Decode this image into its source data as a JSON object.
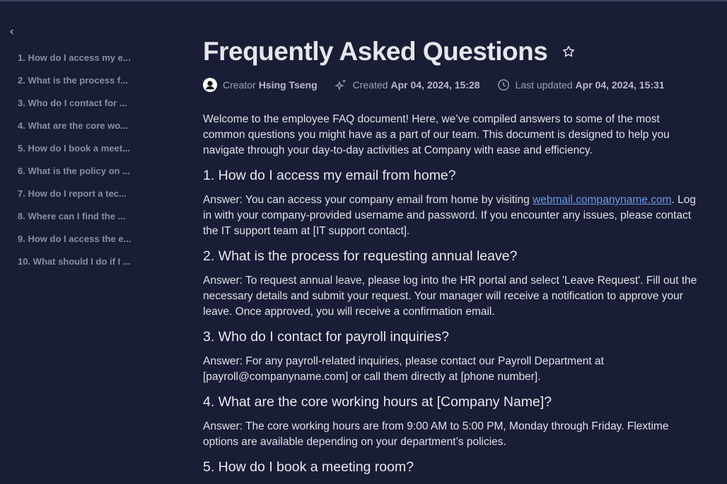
{
  "sidebar": {
    "back_icon": "chevron-left-icon",
    "toc": [
      "1. How do I access my e...",
      "2. What is the process f...",
      "3. Who do I contact for ...",
      "4. What are the core wo...",
      "5. How do I book a meet...",
      "6. What is the policy on ...",
      "7. How do I report a tec...",
      "8. Where can I find the ...",
      "9. How do I access the e...",
      "10. What should I do if I ..."
    ]
  },
  "header": {
    "title": "Frequently Asked Questions",
    "star_icon": "star-outline-icon",
    "creator_label": "Creator",
    "creator_name": "Hsing Tseng",
    "created_label": "Created",
    "created_value": "Apr 04, 2024, 15:28",
    "updated_label": "Last updated",
    "updated_value": "Apr 04, 2024, 15:31"
  },
  "content": {
    "intro": "Welcome to the employee FAQ document! Here, we’ve compiled answers to some of the most common questions you might have as a part of our team. This document is designed to help you navigate through your day-to-day activities at Company with ease and efficiency.",
    "q1": "1. How do I access my email from home?",
    "a1_pre": "Answer: You can access your company email from home by visiting ",
    "a1_link": "webmail.companyname.com",
    "a1_post": ". Log in with your company-provided username and password. If you encounter any issues, please contact the IT support team at [IT support contact].",
    "q2": "2. What is the process for requesting annual leave?",
    "a2": "Answer: To request annual leave, please log into the HR portal and select 'Leave Request'. Fill out the necessary details and submit your request. Your manager will receive a notification to approve your leave. Once approved, you will receive a confirmation email.",
    "q3": "3. Who do I contact for payroll inquiries?",
    "a3": "Answer: For any payroll-related inquiries, please contact our Payroll Department at [payroll@companyname.com] or call them directly at [phone number].",
    "q4": "4. What are the core working hours at [Company Name]?",
    "a4": "Answer: The core working hours are from 9:00 AM to 5:00 PM, Monday through Friday. Flextime options are available depending on your department’s policies.",
    "q5": "5. How do I book a meeting room?"
  },
  "colors": {
    "background": "#191d35",
    "link": "#6b9be8"
  }
}
